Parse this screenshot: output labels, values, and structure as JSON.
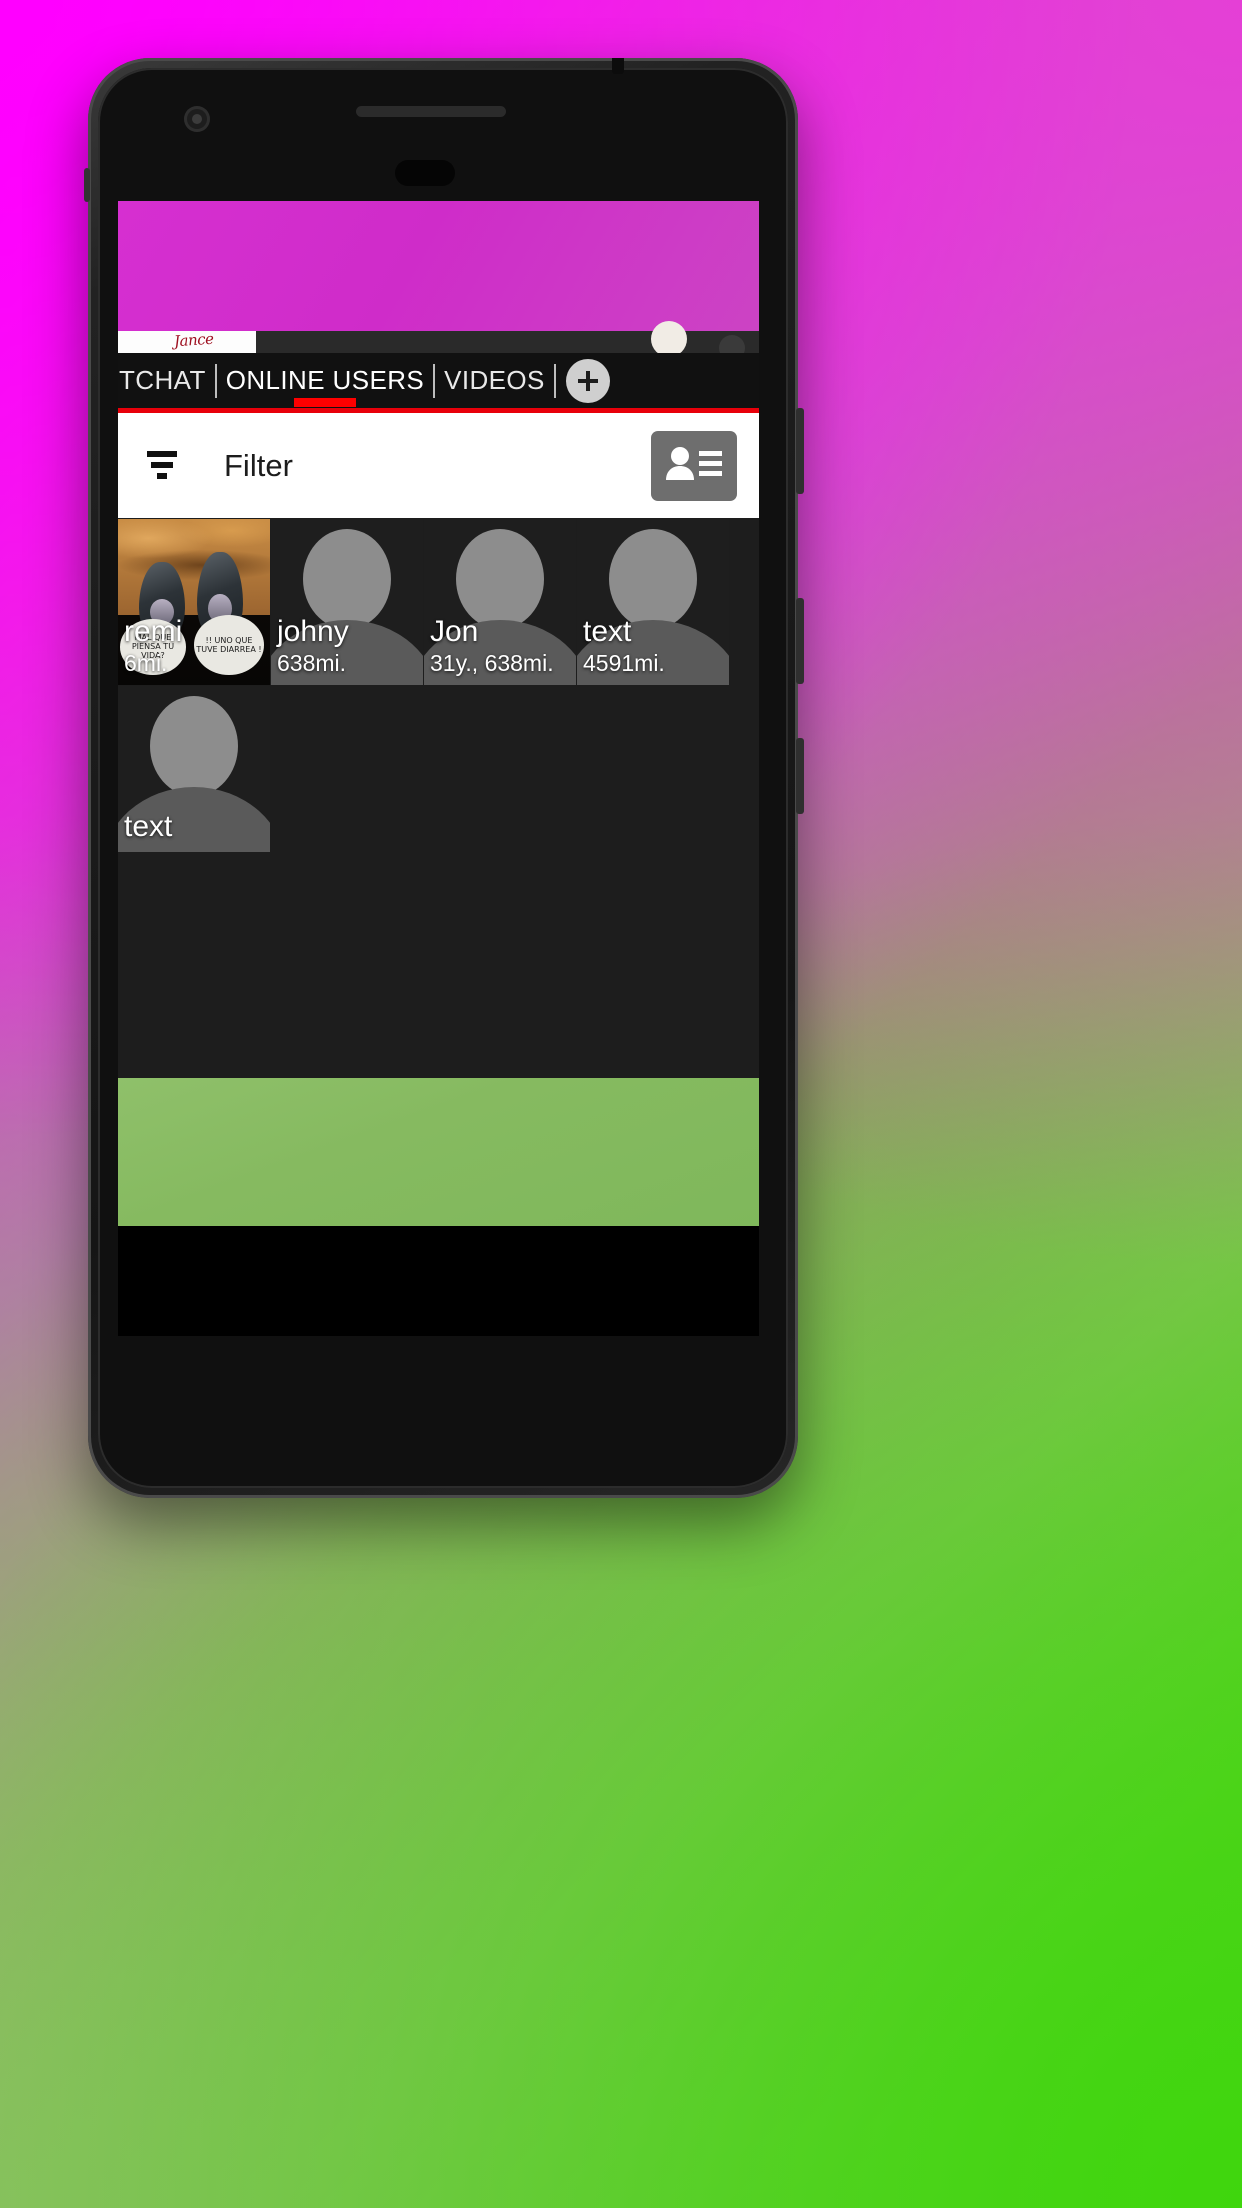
{
  "app": {
    "top_ad": {
      "script_text": "Jance",
      "banner_color": "#d62fd1"
    },
    "bottom_ad": {
      "banner_color": "#8fc06a"
    }
  },
  "tabs": [
    {
      "label": "TCHAT",
      "active": false,
      "truncated": true
    },
    {
      "label": "ONLINE USERS",
      "active": true,
      "truncated": false
    },
    {
      "label": "VIDEOS",
      "active": false,
      "truncated": false
    }
  ],
  "tab_add_button": {
    "icon": "plus-icon",
    "label": "+"
  },
  "accent": {
    "indicator": "#ff0000",
    "rule": "#e8000a"
  },
  "filter_bar": {
    "icon": "filter-sort-icon",
    "label": "Filter",
    "contacts_icon": "contact-card-icon"
  },
  "users": [
    {
      "name": "remi",
      "distance": "6mi.",
      "age": "",
      "has_photo": true,
      "photo_caption_1": "MÁL QUE PIENSA TU VIDA?",
      "photo_caption_2": "!! UNO QUE TUVE DIARREA !"
    },
    {
      "name": "johny",
      "distance": "638mi.",
      "age": "",
      "has_photo": false
    },
    {
      "name": "Jon",
      "distance": "638mi.",
      "age": "31y.",
      "has_photo": false
    },
    {
      "name": "text",
      "distance": "4591mi.",
      "age": "",
      "has_photo": false
    },
    {
      "name": "text",
      "distance": "",
      "age": "",
      "has_photo": false
    }
  ]
}
